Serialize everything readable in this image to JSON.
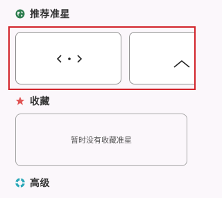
{
  "sections": {
    "recommended": {
      "title": "推荐准星",
      "icon": "globe-icon",
      "icon_color": "#2e7d4f"
    },
    "favorites": {
      "title": "收藏",
      "icon": "star-icon",
      "icon_color": "#e05555",
      "empty_text": "暂时没有收藏准星"
    },
    "advanced": {
      "title": "高级",
      "icon": "lifebuoy-icon",
      "icon_color": "#2aa7b8"
    }
  },
  "reticles": [
    {
      "id": "dot-chevrons",
      "glyph": "<·>"
    },
    {
      "id": "caret",
      "glyph": "^"
    }
  ],
  "colors": {
    "highlight_border": "#d2232a",
    "background": "#fbf7fb"
  }
}
